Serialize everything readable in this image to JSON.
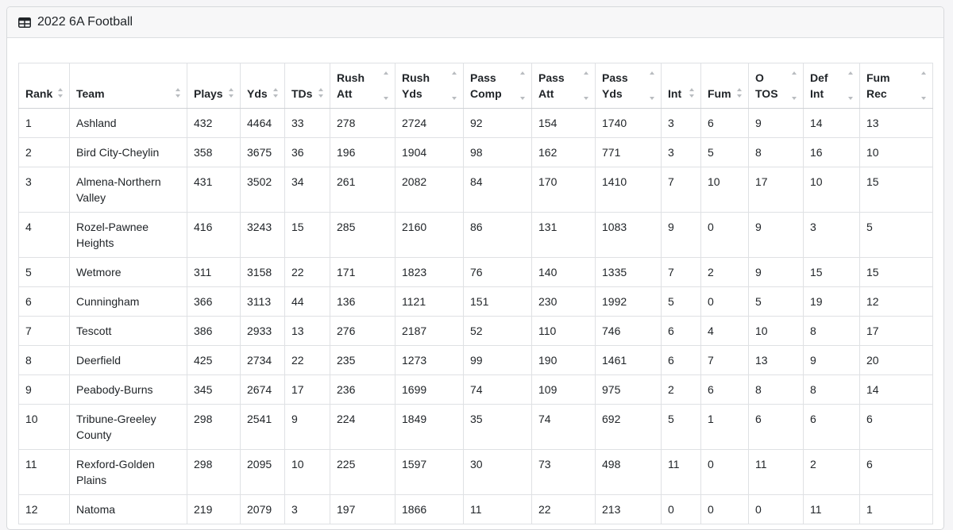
{
  "title": "2022 6A Football",
  "columns": [
    {
      "l1": "",
      "l2": "Rank"
    },
    {
      "l1": "",
      "l2": "Team"
    },
    {
      "l1": "",
      "l2": "Plays"
    },
    {
      "l1": "",
      "l2": "Yds"
    },
    {
      "l1": "",
      "l2": "TDs"
    },
    {
      "l1": "Rush",
      "l2": "Att"
    },
    {
      "l1": "Rush",
      "l2": "Yds"
    },
    {
      "l1": "Pass",
      "l2": "Comp"
    },
    {
      "l1": "Pass",
      "l2": "Att"
    },
    {
      "l1": "Pass",
      "l2": "Yds"
    },
    {
      "l1": "",
      "l2": "Int"
    },
    {
      "l1": "",
      "l2": "Fum"
    },
    {
      "l1": "O",
      "l2": "TOS"
    },
    {
      "l1": "Def",
      "l2": "Int"
    },
    {
      "l1": "Fum",
      "l2": "Rec"
    }
  ],
  "rows": [
    {
      "rank": "1",
      "team": "Ashland",
      "cells": [
        "432",
        "4464",
        "33",
        "278",
        "2724",
        "92",
        "154",
        "1740",
        "3",
        "6",
        "9",
        "14",
        "13"
      ]
    },
    {
      "rank": "2",
      "team": "Bird City-Cheylin",
      "cells": [
        "358",
        "3675",
        "36",
        "196",
        "1904",
        "98",
        "162",
        "771",
        "3",
        "5",
        "8",
        "16",
        "10"
      ]
    },
    {
      "rank": "3",
      "team": "Almena-Northern Valley",
      "cells": [
        "431",
        "3502",
        "34",
        "261",
        "2082",
        "84",
        "170",
        "1410",
        "7",
        "10",
        "17",
        "10",
        "15"
      ]
    },
    {
      "rank": "4",
      "team": "Rozel-Pawnee Heights",
      "cells": [
        "416",
        "3243",
        "15",
        "285",
        "2160",
        "86",
        "131",
        "1083",
        "9",
        "0",
        "9",
        "3",
        "5"
      ]
    },
    {
      "rank": "5",
      "team": "Wetmore",
      "cells": [
        "311",
        "3158",
        "22",
        "171",
        "1823",
        "76",
        "140",
        "1335",
        "7",
        "2",
        "9",
        "15",
        "15"
      ]
    },
    {
      "rank": "6",
      "team": "Cunningham",
      "cells": [
        "366",
        "3113",
        "44",
        "136",
        "1121",
        "151",
        "230",
        "1992",
        "5",
        "0",
        "5",
        "19",
        "12"
      ]
    },
    {
      "rank": "7",
      "team": "Tescott",
      "cells": [
        "386",
        "2933",
        "13",
        "276",
        "2187",
        "52",
        "110",
        "746",
        "6",
        "4",
        "10",
        "8",
        "17"
      ]
    },
    {
      "rank": "8",
      "team": "Deerfield",
      "cells": [
        "425",
        "2734",
        "22",
        "235",
        "1273",
        "99",
        "190",
        "1461",
        "6",
        "7",
        "13",
        "9",
        "20"
      ]
    },
    {
      "rank": "9",
      "team": "Peabody-Burns",
      "cells": [
        "345",
        "2674",
        "17",
        "236",
        "1699",
        "74",
        "109",
        "975",
        "2",
        "6",
        "8",
        "8",
        "14"
      ]
    },
    {
      "rank": "10",
      "team": "Tribune-Greeley County",
      "cells": [
        "298",
        "2541",
        "9",
        "224",
        "1849",
        "35",
        "74",
        "692",
        "5",
        "1",
        "6",
        "6",
        "6"
      ]
    },
    {
      "rank": "11",
      "team": "Rexford-Golden Plains",
      "cells": [
        "298",
        "2095",
        "10",
        "225",
        "1597",
        "30",
        "73",
        "498",
        "11",
        "0",
        "11",
        "2",
        "6"
      ]
    },
    {
      "rank": "12",
      "team": "Natoma",
      "cells": [
        "219",
        "2079",
        "3",
        "197",
        "1866",
        "11",
        "22",
        "213",
        "0",
        "0",
        "0",
        "11",
        "1"
      ]
    }
  ]
}
